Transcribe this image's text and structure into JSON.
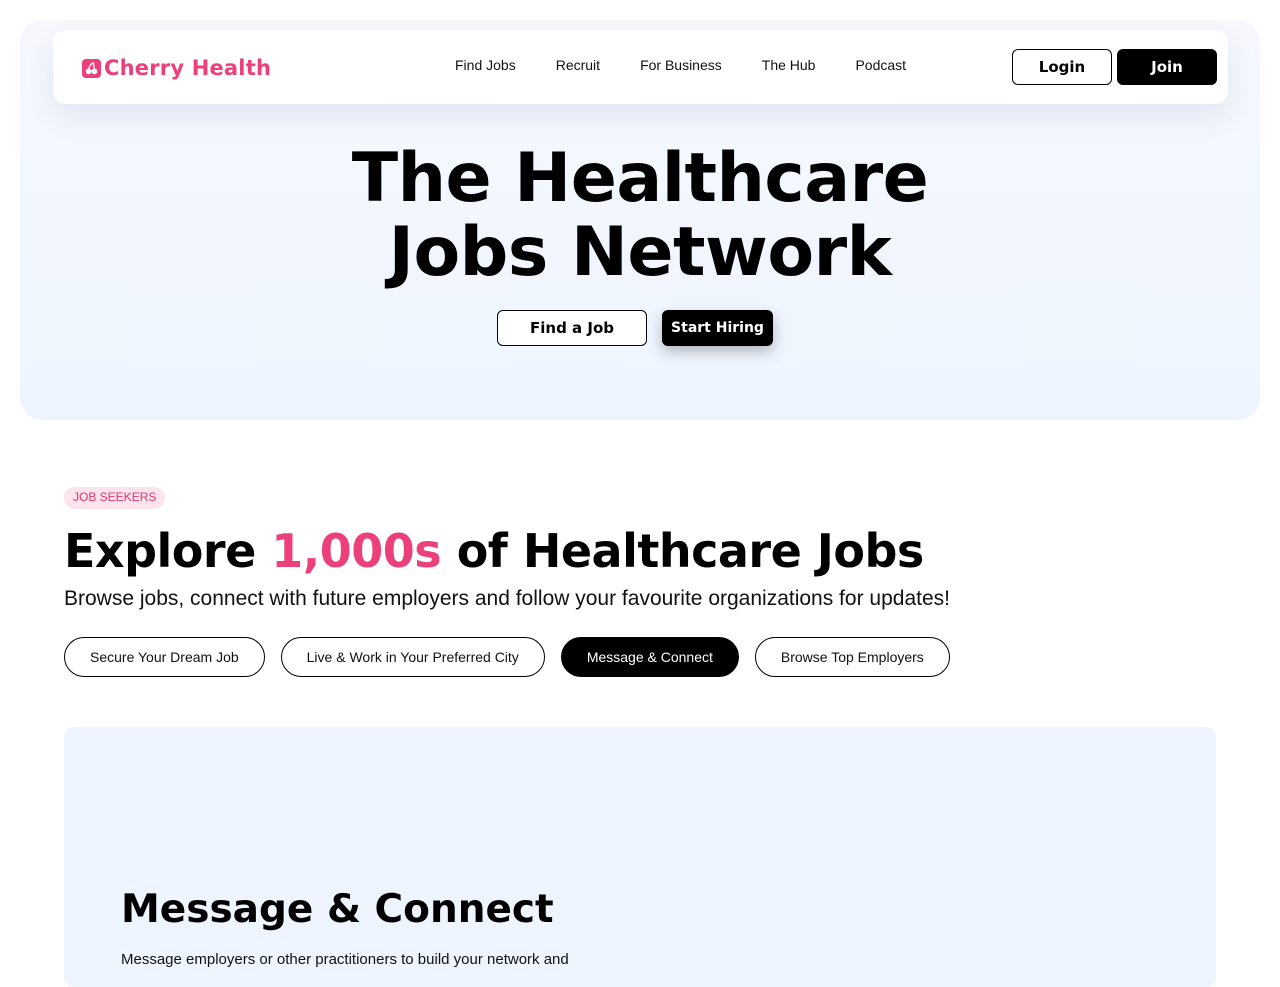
{
  "brand": {
    "name": "Cherry Health",
    "accent_color": "#ec407a",
    "logo_icon": "cherry-icon"
  },
  "nav": {
    "links": [
      "Find Jobs",
      "Recruit",
      "For Business",
      "The Hub",
      "Podcast"
    ],
    "login_label": "Login",
    "join_label": "Join"
  },
  "hero": {
    "title_line1": "The Healthcare",
    "title_line2": "Jobs Network",
    "find_job_label": "Find a Job",
    "start_hiring_label": "Start Hiring"
  },
  "job_seekers": {
    "badge": "JOB SEEKERS",
    "title_prefix": "Explore ",
    "title_accent": "1,000s",
    "title_suffix": " of Healthcare Jobs",
    "subtitle": "Browse jobs, connect with future employers and follow your favourite organizations for updates!",
    "tabs": [
      {
        "label": "Secure Your Dream Job",
        "active": false
      },
      {
        "label": "Live & Work in Your Preferred City",
        "active": false
      },
      {
        "label": "Message & Connect",
        "active": true
      },
      {
        "label": "Browse Top Employers",
        "active": false
      }
    ]
  },
  "feature": {
    "title": "Message & Connect",
    "text": "Message employers or other practitioners to build your network and"
  }
}
